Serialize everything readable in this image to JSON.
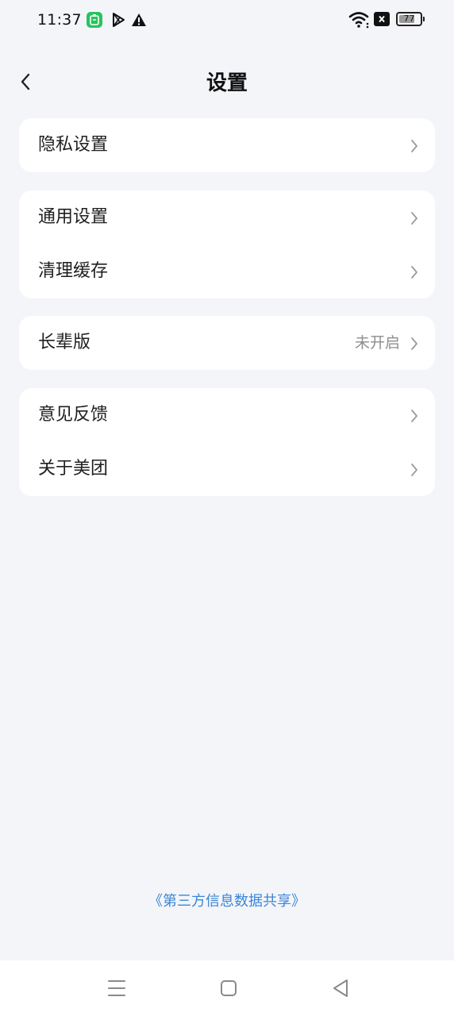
{
  "status_bar": {
    "time": "11:37",
    "battery": "77",
    "battery_level": 0.77,
    "icons": [
      "app-notification-icon",
      "play-store-icon",
      "warning-icon",
      "wifi-icon",
      "no-sim-icon",
      "battery-icon"
    ],
    "app_icon_color": "#28c35f"
  },
  "header": {
    "title": "设置",
    "back_icon": "chevron-left-icon"
  },
  "groups": [
    {
      "items": [
        {
          "label": "隐私设置"
        }
      ]
    },
    {
      "items": [
        {
          "label": "通用设置"
        },
        {
          "label": "清理缓存"
        }
      ]
    },
    {
      "items": [
        {
          "label": "长辈版",
          "value": "未开启"
        }
      ]
    },
    {
      "items": [
        {
          "label": "意见反馈"
        },
        {
          "label": "关于美团"
        }
      ]
    }
  ],
  "footer": {
    "link_text": "《第三方信息数据共享》",
    "link_color": "#3a86d6"
  },
  "nav_bar": {
    "icons": [
      "menu-icon",
      "home-icon",
      "back-triangle-icon"
    ]
  },
  "colors": {
    "background": "#f4f5f9",
    "card": "#ffffff",
    "secondary_text": "#8e8e8e",
    "chevron": "#9b9b9b"
  }
}
